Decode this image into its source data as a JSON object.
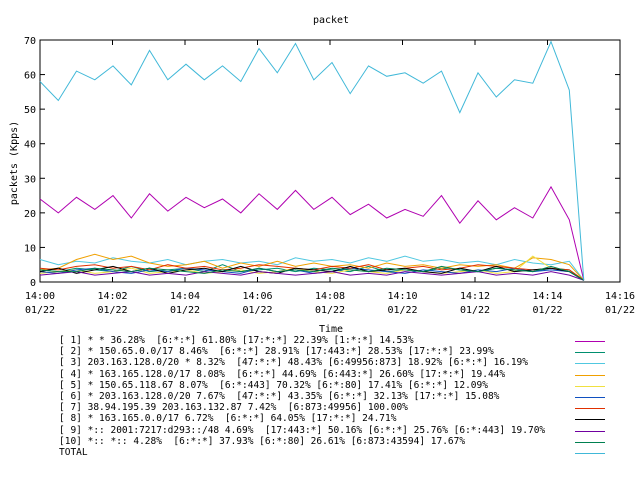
{
  "chart_data": {
    "type": "line",
    "title": "packet",
    "xlabel": "Time",
    "ylabel": "packets (Kpps)",
    "ylim": [
      0,
      70
    ],
    "yticks": [
      0,
      10,
      20,
      30,
      40,
      50,
      60,
      70
    ],
    "xticks": [
      {
        "t": "14:00",
        "d": "01/22"
      },
      {
        "t": "14:02",
        "d": "01/22"
      },
      {
        "t": "14:04",
        "d": "01/22"
      },
      {
        "t": "14:06",
        "d": "01/22"
      },
      {
        "t": "14:08",
        "d": "01/22"
      },
      {
        "t": "14:10",
        "d": "01/22"
      },
      {
        "t": "14:12",
        "d": "01/22"
      },
      {
        "t": "14:14",
        "d": "01/22"
      },
      {
        "t": "14:16",
        "d": "01/22"
      }
    ],
    "x_minutes": [
      0.0,
      0.33,
      0.67,
      1.0,
      1.33,
      1.67,
      2.0,
      2.33,
      2.67,
      3.0,
      3.33,
      3.67,
      4.0,
      4.33,
      4.67,
      5.0,
      5.33,
      5.67,
      6.0,
      6.33,
      6.67,
      7.0,
      7.33,
      7.67,
      8.0,
      8.33,
      8.67,
      9.0,
      9.33,
      9.67,
      10.0,
      10.33,
      10.67,
      11.0,
      11.33,
      11.67,
      12.0,
      12.33,
      12.67,
      13.0,
      13.33,
      13.67,
      14.0,
      14.33,
      14.67,
      15.0
    ],
    "series": [
      {
        "name": "[ 1] * * 36.28%  [6:*:*] 61.80% [17:*:*] 22.39% [1:*:*] 14.53%",
        "color": "#b000b0",
        "values": [
          24.0,
          20.0,
          24.5,
          21.0,
          25.0,
          18.5,
          25.5,
          20.5,
          24.5,
          21.5,
          24.0,
          20.0,
          25.5,
          21.0,
          26.5,
          21.0,
          24.5,
          19.5,
          22.5,
          18.5,
          21.0,
          19.0,
          25.0,
          17.0,
          23.5,
          18.0,
          21.5,
          18.5,
          27.5,
          18.0,
          0.5
        ]
      },
      {
        "name": "[ 2] * 150.65.0.0/17 8.46%  [6:*:*] 28.91% [17:443:*] 28.53% [17:*:*] 23.99%",
        "color": "#008f6f",
        "values": [
          3.5,
          3.0,
          4.0,
          3.5,
          3.0,
          4.5,
          3.0,
          3.5,
          4.0,
          3.0,
          5.0,
          3.0,
          3.5,
          4.0,
          3.0,
          4.0,
          3.5,
          3.0,
          4.5,
          3.0,
          3.5,
          3.0,
          4.0,
          3.5,
          3.0,
          4.0,
          3.5,
          3.0,
          4.0,
          3.5,
          0.5
        ]
      },
      {
        "name": "[ 3] 203.163.128.0/20 * 8.32%  [47:*:*] 48.43% [6:49956:873] 18.92% [6:*:*] 16.19%",
        "color": "#50c8e0",
        "values": [
          6.5,
          5.0,
          6.0,
          5.5,
          7.0,
          6.0,
          5.5,
          6.5,
          5.0,
          6.0,
          6.5,
          5.5,
          6.0,
          5.0,
          7.0,
          6.0,
          6.5,
          5.5,
          7.0,
          6.0,
          7.5,
          6.0,
          6.5,
          5.5,
          6.0,
          5.0,
          6.5,
          5.5,
          5.0,
          6.0,
          0.5
        ]
      },
      {
        "name": "[ 4] * 163.165.128.0/17 8.08%  [6:*:*] 44.69% [6:443:*] 26.60% [17:*:*] 19.44%",
        "color": "#f0a000",
        "values": [
          3.5,
          4.0,
          6.5,
          8.0,
          6.5,
          7.5,
          5.5,
          4.5,
          5.0,
          6.0,
          4.0,
          5.5,
          4.5,
          6.0,
          4.5,
          5.5,
          4.5,
          5.0,
          4.0,
          5.5,
          4.5,
          5.0,
          4.0,
          5.0,
          4.5,
          5.0,
          4.0,
          7.0,
          6.5,
          5.0,
          0.5
        ]
      },
      {
        "name": "[ 5] * 150.65.118.67 8.07%  [6:*:443] 70.32% [6:*:80] 17.41% [6:*:*] 12.09%",
        "color": "#f0e040",
        "values": [
          2.5,
          3.0,
          3.5,
          2.5,
          3.0,
          4.0,
          2.5,
          3.0,
          3.5,
          2.5,
          3.0,
          3.5,
          2.5,
          3.0,
          4.0,
          3.0,
          2.5,
          3.5,
          3.0,
          2.5,
          3.5,
          3.0,
          2.5,
          3.0,
          3.5,
          2.5,
          3.0,
          7.5,
          4.0,
          3.0,
          0.5
        ]
      },
      {
        "name": "[ 6] * 203.163.128.0/20 7.67%  [47:*:*] 43.35% [6:*:*] 32.13% [17:*:*] 15.08%",
        "color": "#1050c0",
        "values": [
          3.0,
          2.5,
          3.5,
          4.0,
          3.0,
          2.5,
          3.5,
          3.0,
          4.0,
          3.5,
          3.0,
          2.5,
          4.0,
          3.0,
          3.5,
          2.5,
          3.0,
          4.0,
          3.5,
          3.0,
          2.5,
          3.5,
          3.0,
          2.5,
          3.5,
          3.0,
          4.0,
          3.0,
          3.5,
          3.0,
          0.5
        ]
      },
      {
        "name": "[ 7] 38.94.195.39 203.163.132.87 7.42%  [6:873:49956] 100.00%",
        "color": "#e03000",
        "values": [
          4.0,
          3.5,
          4.5,
          5.0,
          4.0,
          4.5,
          3.5,
          5.0,
          4.0,
          4.5,
          3.5,
          4.0,
          5.0,
          4.5,
          4.0,
          3.5,
          4.5,
          4.0,
          5.0,
          3.5,
          4.0,
          4.5,
          3.5,
          4.0,
          5.0,
          4.5,
          4.0,
          3.5,
          4.0,
          3.5,
          0.5
        ]
      },
      {
        "name": "[ 8] * 163.165.0.0/17 6.72%  [6:*:*] 64.05% [17:*:*] 24.71%",
        "color": "#000000",
        "values": [
          3.0,
          4.0,
          2.5,
          3.5,
          4.5,
          3.0,
          4.0,
          2.5,
          3.5,
          4.0,
          3.0,
          4.5,
          3.0,
          2.5,
          4.0,
          3.5,
          3.0,
          4.5,
          3.0,
          3.5,
          4.0,
          3.0,
          2.5,
          4.0,
          3.0,
          4.5,
          3.0,
          3.5,
          4.0,
          3.0,
          0.5
        ]
      },
      {
        "name": "[ 9] *:: 2001:7217:d293::/48 4.69%  [17:443:*] 50.16% [6:*:*] 25.76% [6:*:443] 19.70%",
        "color": "#7000a0",
        "values": [
          2.0,
          2.5,
          3.0,
          2.0,
          2.5,
          3.0,
          2.0,
          2.5,
          2.0,
          3.0,
          2.5,
          2.0,
          3.0,
          2.5,
          2.0,
          2.5,
          3.0,
          2.0,
          2.5,
          2.0,
          3.0,
          2.5,
          2.0,
          2.5,
          3.0,
          2.0,
          2.5,
          2.0,
          3.0,
          2.0,
          0.5
        ]
      },
      {
        "name": "[10] *:: *:: 4.28%  [6:*:*] 37.93% [6:*:80] 26.61% [6:873:43594] 17.67%",
        "color": "#008050",
        "values": [
          3.5,
          3.0,
          3.0,
          4.0,
          3.5,
          3.0,
          4.0,
          3.5,
          3.0,
          2.5,
          3.5,
          3.0,
          4.0,
          3.0,
          3.5,
          3.0,
          4.0,
          3.5,
          3.0,
          4.0,
          3.5,
          3.0,
          4.5,
          3.5,
          3.0,
          4.0,
          3.5,
          3.0,
          4.5,
          3.0,
          0.5
        ]
      },
      {
        "name": "TOTAL",
        "color": "#40b8d8",
        "values": [
          58.0,
          52.5,
          61.0,
          58.5,
          62.5,
          57.0,
          67.0,
          58.5,
          63.0,
          58.5,
          62.5,
          58.0,
          67.5,
          60.5,
          69.0,
          58.5,
          63.5,
          54.5,
          62.5,
          59.5,
          60.5,
          57.5,
          61.0,
          49.0,
          60.5,
          53.5,
          58.5,
          57.5,
          69.5,
          55.5,
          0.5
        ]
      }
    ]
  }
}
